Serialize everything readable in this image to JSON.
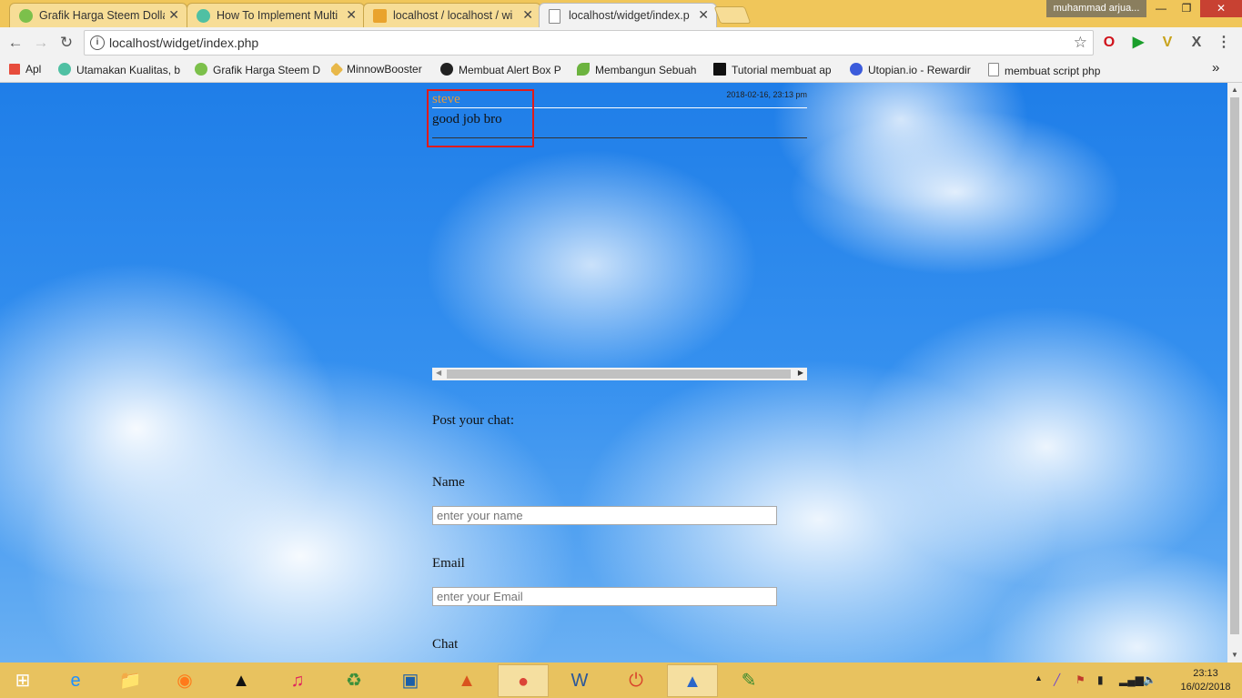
{
  "browser": {
    "tabs": [
      {
        "title": "Grafik Harga Steem Dolla",
        "icon": "steem-icon",
        "color": "#7cc04b"
      },
      {
        "title": "How To Implement Multi",
        "icon": "steemit-icon",
        "color": "#4fc0a3"
      },
      {
        "title": "localhost / localhost / wi",
        "icon": "phpmyadmin-icon",
        "color": "#e9a32d"
      },
      {
        "title": "localhost/widget/index.p",
        "icon": "page-icon",
        "color": "#888888"
      }
    ],
    "user": "muhammad arjua...",
    "window_buttons": {
      "minimize": "—",
      "maximize": "❐",
      "close": "✕"
    },
    "url": "localhost/widget/index.php",
    "bookmarks": [
      {
        "label": "Apl",
        "icon": "apps-icon",
        "color": "#e74c3c"
      },
      {
        "label": "Utamakan Kualitas, b",
        "icon": "steemit-icon",
        "color": "#4fc0a3"
      },
      {
        "label": "Grafik Harga Steem D",
        "icon": "steem-icon",
        "color": "#7cc04b"
      },
      {
        "label": "MinnowBooster",
        "icon": "minnow-icon",
        "color": "#e8b84a"
      },
      {
        "label": "Membuat Alert Box P",
        "icon": "steem-s-icon",
        "color": "#222222"
      },
      {
        "label": "Membangun Sebuah",
        "icon": "leaf-icon",
        "color": "#6cb33f"
      },
      {
        "label": "Tutorial membuat ap",
        "icon": "medium-icon",
        "color": "#111111"
      },
      {
        "label": "Utopian.io - Rewardir",
        "icon": "utopian-icon",
        "color": "#3b5bdb"
      },
      {
        "label": "membuat script php",
        "icon": "page-icon",
        "color": "#888888"
      }
    ],
    "bookmarks_more": "»"
  },
  "chat": {
    "name": "steve",
    "time": "2018-02-16, 23:13 pm",
    "message": "good job bro"
  },
  "form": {
    "heading": "Post your chat:",
    "name_label": "Name",
    "name_placeholder": "enter your name",
    "email_label": "Email",
    "email_placeholder": "enter your Email",
    "chat_label": "Chat"
  },
  "taskbar": {
    "apps": [
      {
        "name": "internet-explorer-icon",
        "glyph": "e",
        "color": "#1e90ff"
      },
      {
        "name": "file-explorer-icon",
        "glyph": "📁",
        "color": "#d9a521"
      },
      {
        "name": "uc-browser-icon",
        "glyph": "◉",
        "color": "#ff7a1a"
      },
      {
        "name": "aimp-icon",
        "glyph": "▲",
        "color": "#111111"
      },
      {
        "name": "itunes-icon",
        "glyph": "♫",
        "color": "#e0245e"
      },
      {
        "name": "recycle-tool-icon",
        "glyph": "♻",
        "color": "#3a8f3a"
      },
      {
        "name": "virtualbox-icon",
        "glyph": "▣",
        "color": "#1b5fa8"
      },
      {
        "name": "matlab-icon",
        "glyph": "▲",
        "color": "#d9531e"
      },
      {
        "name": "chrome-icon",
        "glyph": "●",
        "color": "#db4437"
      },
      {
        "name": "word-icon",
        "glyph": "W",
        "color": "#2b579a"
      },
      {
        "name": "power-app-icon",
        "glyph": "⏻",
        "color": "#d9442b"
      },
      {
        "name": "vlc-icon",
        "glyph": "▲",
        "color": "#2a66c9"
      },
      {
        "name": "notepad-plus-icon",
        "glyph": "✎",
        "color": "#3c8a2e"
      }
    ],
    "time": "23:13",
    "date": "16/02/2018"
  }
}
